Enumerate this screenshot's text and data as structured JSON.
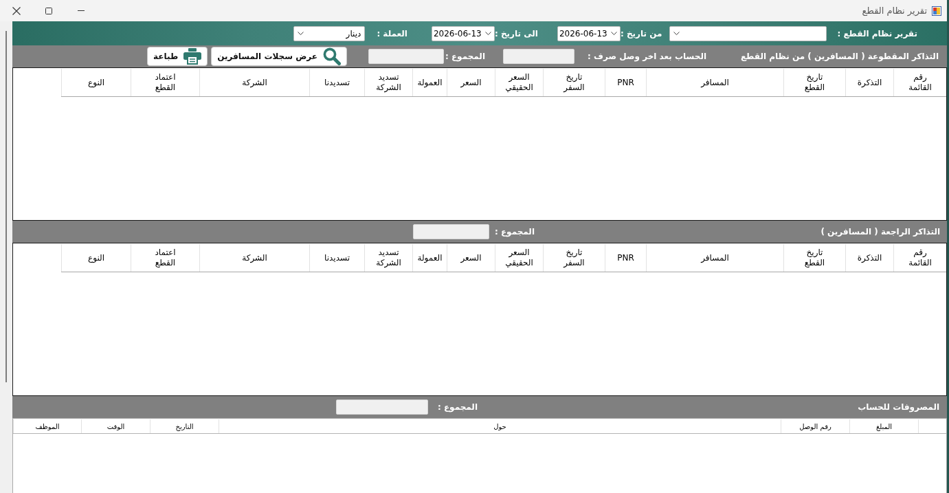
{
  "window": {
    "title": "تقرير نظام القطع"
  },
  "filter_bar": {
    "report_label": "تقرير نظام القطع :",
    "from_label": "من تاريخ :",
    "from_date": "2026-06-13",
    "to_label": "الى تاريخ :",
    "to_date": "2026-06-13",
    "currency_label": "العملة :",
    "currency": "دينار"
  },
  "sections": [
    {
      "title": "التذاكر المقطوعة ( المسافرين ) من نظام القطع",
      "fields": [
        {
          "label": "الحساب بعد اخر وصل صرف :"
        },
        {
          "label": "المجموع :"
        }
      ],
      "buttons": [
        {
          "kind": "search",
          "label": "عرض سجلات المسافرين"
        },
        {
          "kind": "print",
          "label": "طباعة"
        }
      ],
      "table": {
        "kind": "tall",
        "columns": [
          "رقم القائمة",
          "التذكرة",
          "تاريخ القطع",
          "المسافر",
          "PNR",
          "تاريخ السفر",
          "السعر الحقيقي",
          "السعر",
          "العمولة",
          "تسديد الشركة",
          "تسديدنا",
          "الشركة",
          "اعتماد القطع",
          "النوع"
        ]
      }
    },
    {
      "title": "التذاكر الراجعة ( المسافرين )",
      "fields": [
        {
          "label": "المجموع :"
        }
      ],
      "table": {
        "kind": "tall",
        "columns": [
          "رقم القائمة",
          "التذكرة",
          "تاريخ القطع",
          "المسافر",
          "PNR",
          "تاريخ السفر",
          "السعر الحقيقي",
          "السعر",
          "العمولة",
          "تسديد الشركة",
          "تسديدنا",
          "الشركة",
          "اعتماد القطع",
          "النوع"
        ]
      }
    },
    {
      "title": "المصروفات للحساب",
      "fields": [
        {
          "label": "المجموع :"
        }
      ],
      "table": {
        "kind": "compact",
        "columns": [
          "المبلغ",
          "رقم الوصل",
          "حول",
          "التاريخ",
          "الوقت",
          "الموظف"
        ]
      }
    }
  ]
}
